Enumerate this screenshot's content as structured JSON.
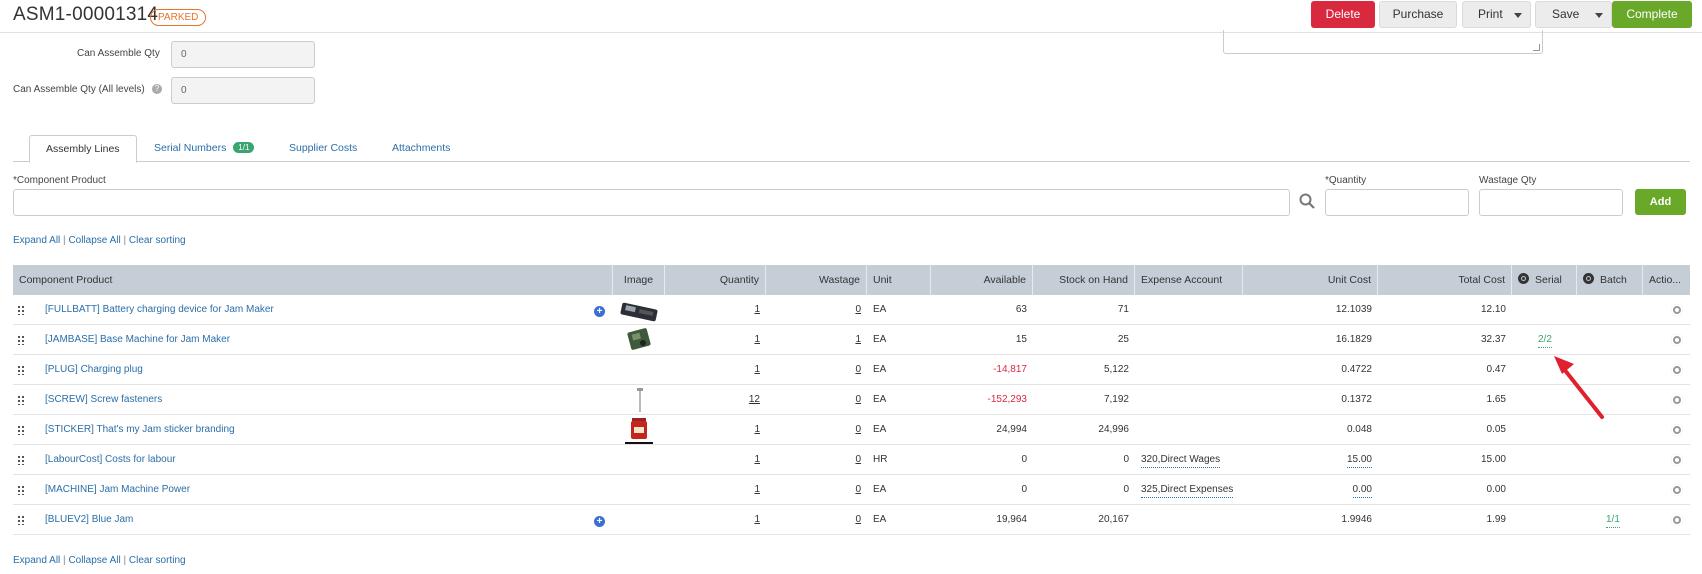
{
  "header": {
    "doc_number": "ASM1-00001314",
    "status": "PARKED",
    "buttons": {
      "delete": "Delete",
      "purchase": "Purchase",
      "print": "Print",
      "save": "Save",
      "complete": "Complete"
    }
  },
  "form": {
    "can_assemble_label": "Can Assemble Qty",
    "can_assemble_value": "0",
    "can_assemble_all_label": "Can Assemble Qty (All levels)",
    "can_assemble_all_value": "0"
  },
  "tabs": [
    {
      "label": "Assembly Lines",
      "badge": ""
    },
    {
      "label": "Serial Numbers",
      "badge": "1/1"
    },
    {
      "label": "Supplier Costs",
      "badge": ""
    },
    {
      "label": "Attachments",
      "badge": ""
    }
  ],
  "add_line": {
    "component_label": "*Component Product",
    "quantity_label": "*Quantity",
    "wastage_label": "Wastage Qty",
    "add_label": "Add"
  },
  "links": {
    "expand": "Expand All",
    "collapse": "Collapse All",
    "clear": "Clear sorting"
  },
  "table": {
    "columns": [
      "Component Product",
      "Image",
      "Quantity",
      "Wastage",
      "Unit",
      "Available",
      "Stock on Hand",
      "Expense Account",
      "Unit Cost",
      "Total Cost",
      "Serial",
      "Batch",
      "Actio..."
    ],
    "rows": [
      {
        "product": "[FULLBATT] Battery charging device for Jam Maker",
        "quantity": "1",
        "wastage": "0",
        "unit": "EA",
        "available": "63",
        "soh": "71",
        "expense": "",
        "unit_cost": "12.1039",
        "total_cost": "12.10",
        "serial": "",
        "batch": ""
      },
      {
        "product": "[JAMBASE] Base Machine for Jam Maker",
        "quantity": "1",
        "wastage": "1",
        "unit": "EA",
        "available": "15",
        "soh": "25",
        "expense": "",
        "unit_cost": "16.1829",
        "total_cost": "32.37",
        "serial": "2/2",
        "batch": ""
      },
      {
        "product": "[PLUG] Charging plug",
        "quantity": "1",
        "wastage": "0",
        "unit": "EA",
        "available": "-14,817",
        "soh": "5,122",
        "expense": "",
        "unit_cost": "0.4722",
        "total_cost": "0.47",
        "serial": "",
        "batch": ""
      },
      {
        "product": "[SCREW] Screw fasteners",
        "quantity": "12",
        "wastage": "0",
        "unit": "EA",
        "available": "-152,293",
        "soh": "7,192",
        "expense": "",
        "unit_cost": "0.1372",
        "total_cost": "1.65",
        "serial": "",
        "batch": ""
      },
      {
        "product": "[STICKER] That's my Jam sticker branding",
        "quantity": "1",
        "wastage": "0",
        "unit": "EA",
        "available": "24,994",
        "soh": "24,996",
        "expense": "",
        "unit_cost": "0.048",
        "total_cost": "0.05",
        "serial": "",
        "batch": ""
      },
      {
        "product": "[LabourCost] Costs for labour",
        "quantity": "1",
        "wastage": "0",
        "unit": "HR",
        "available": "0",
        "soh": "0",
        "expense": "320,Direct Wages",
        "unit_cost": "15.00",
        "total_cost": "15.00",
        "serial": "",
        "batch": ""
      },
      {
        "product": "[MACHINE] Jam Machine Power",
        "quantity": "1",
        "wastage": "0",
        "unit": "EA",
        "available": "0",
        "soh": "0",
        "expense": "325,Direct Expenses",
        "unit_cost": "0.00",
        "total_cost": "0.00",
        "serial": "",
        "batch": ""
      },
      {
        "product": "[BLUEV2] Blue Jam",
        "quantity": "1",
        "wastage": "0",
        "unit": "EA",
        "available": "19,964",
        "soh": "20,167",
        "expense": "",
        "unit_cost": "1.9946",
        "total_cost": "1.99",
        "serial": "",
        "batch": "1/1"
      }
    ]
  },
  "colors": {
    "accent_green": "#6aa829",
    "delete_red": "#d9293f",
    "status_orange": "#e8732c",
    "header_grey": "#c5ced7",
    "link_blue": "#2a6ea9"
  }
}
